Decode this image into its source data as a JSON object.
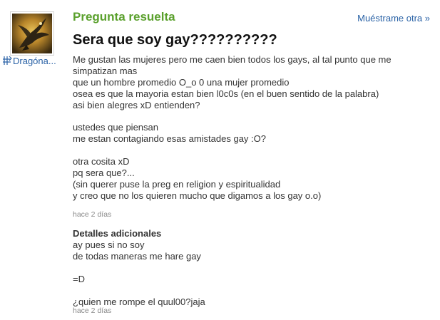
{
  "question": {
    "status": "Pregunta resuelta",
    "next_link": "Muéstrame otra »",
    "title": "Sera que soy gay??????????",
    "body_lines": [
      "Me gustan las mujeres pero me caen bien todos los gays, al tal punto que me",
      "simpatizan mas",
      "que un hombre promedio O_o 0 una mujer promedio",
      "osea es que la mayoria estan bien l0c0s (en el buen sentido de la palabra)",
      "asi bien alegres xD entienden?",
      "",
      "ustedes que piensan",
      "me estan contagiando esas amistades gay :O?",
      "",
      "otra cosita xD",
      "pq sera que?...",
      "(sin querer puse la preg en religion y espiritualidad",
      "y creo que no los quieren mucho que digamos a los gay o.o)"
    ],
    "timestamp": "hace 2 días"
  },
  "user": {
    "name": "Dragóna...",
    "badge_icon": "level-badge-icon",
    "avatar_icon": "dragon-avatar-icon"
  },
  "details": {
    "title": "Detalles adicionales",
    "lines": [
      "ay pues si no soy",
      "de todas maneras me hare gay",
      "",
      "=D",
      "",
      "¿quien me rompe el quul00?jaja"
    ],
    "timestamp": "hace 2 días"
  },
  "colors": {
    "status_green": "#5aa02c",
    "link_blue": "#2a62a6",
    "meta_gray": "#8a8a8a"
  }
}
